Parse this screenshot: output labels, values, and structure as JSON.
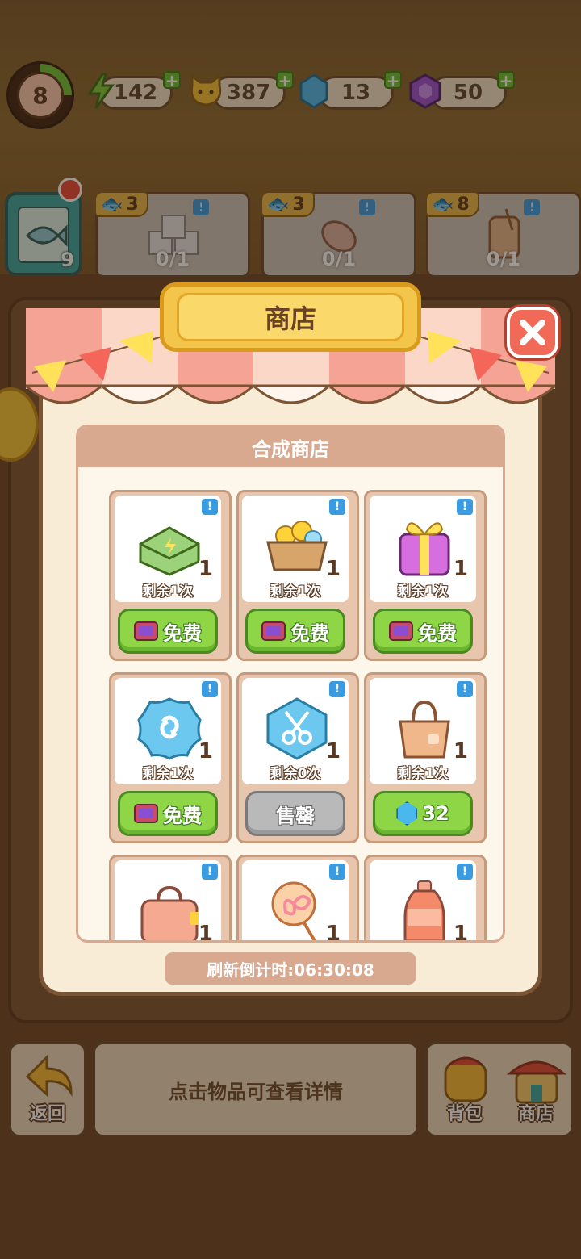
{
  "level": "8",
  "resources": [
    {
      "icon": "energy-bolt-icon",
      "value": "142"
    },
    {
      "icon": "cat-coin-icon",
      "value": "387"
    },
    {
      "icon": "blue-gem-icon",
      "value": "13"
    },
    {
      "icon": "purple-gem-icon",
      "value": "50"
    }
  ],
  "fish_card": {
    "count": "9"
  },
  "orders": [
    {
      "cost": "3",
      "progress": "0/1",
      "item": "sugar-cubes"
    },
    {
      "cost": "3",
      "progress": "0/1",
      "item": "candy"
    },
    {
      "cost": "8",
      "progress": "0/1",
      "item": "juice-jar"
    }
  ],
  "shop": {
    "title": "商店",
    "section_title": "合成商店",
    "items": [
      {
        "name": "green-box",
        "qty": "1",
        "remaining": "剩余1次",
        "button": "免费",
        "type": "free"
      },
      {
        "name": "coin-crate",
        "qty": "1",
        "remaining": "剩余1次",
        "button": "免费",
        "type": "free"
      },
      {
        "name": "gift-box",
        "qty": "1",
        "remaining": "剩余1次",
        "button": "免费",
        "type": "free"
      },
      {
        "name": "blue-token",
        "qty": "1",
        "remaining": "剩余1次",
        "button": "免费",
        "type": "free"
      },
      {
        "name": "scissors-token",
        "qty": "1",
        "remaining": "剩余0次",
        "button": "售罄",
        "type": "sold"
      },
      {
        "name": "tote-bag",
        "qty": "1",
        "remaining": "剩余1次",
        "button": "32",
        "type": "gem"
      },
      {
        "name": "pink-case",
        "qty": "1",
        "remaining": "",
        "button": "",
        "type": "hidden"
      },
      {
        "name": "lollipop",
        "qty": "1",
        "remaining": "",
        "button": "",
        "type": "hidden"
      },
      {
        "name": "juice-bottle",
        "qty": "1",
        "remaining": "",
        "button": "",
        "type": "hidden"
      }
    ],
    "refresh_timer": "刷新倒计时:06:30:08"
  },
  "bottom": {
    "back_label": "返回",
    "hint": "点击物品可查看详情",
    "bag_label": "背包",
    "shop_label": "商店"
  },
  "colors": {
    "button_green": "#8ed646",
    "sold_gray": "#b9b9b9",
    "panel_header": "#d8a98f",
    "close_red": "#f06a57",
    "title_yellow": "#f3c54b"
  }
}
